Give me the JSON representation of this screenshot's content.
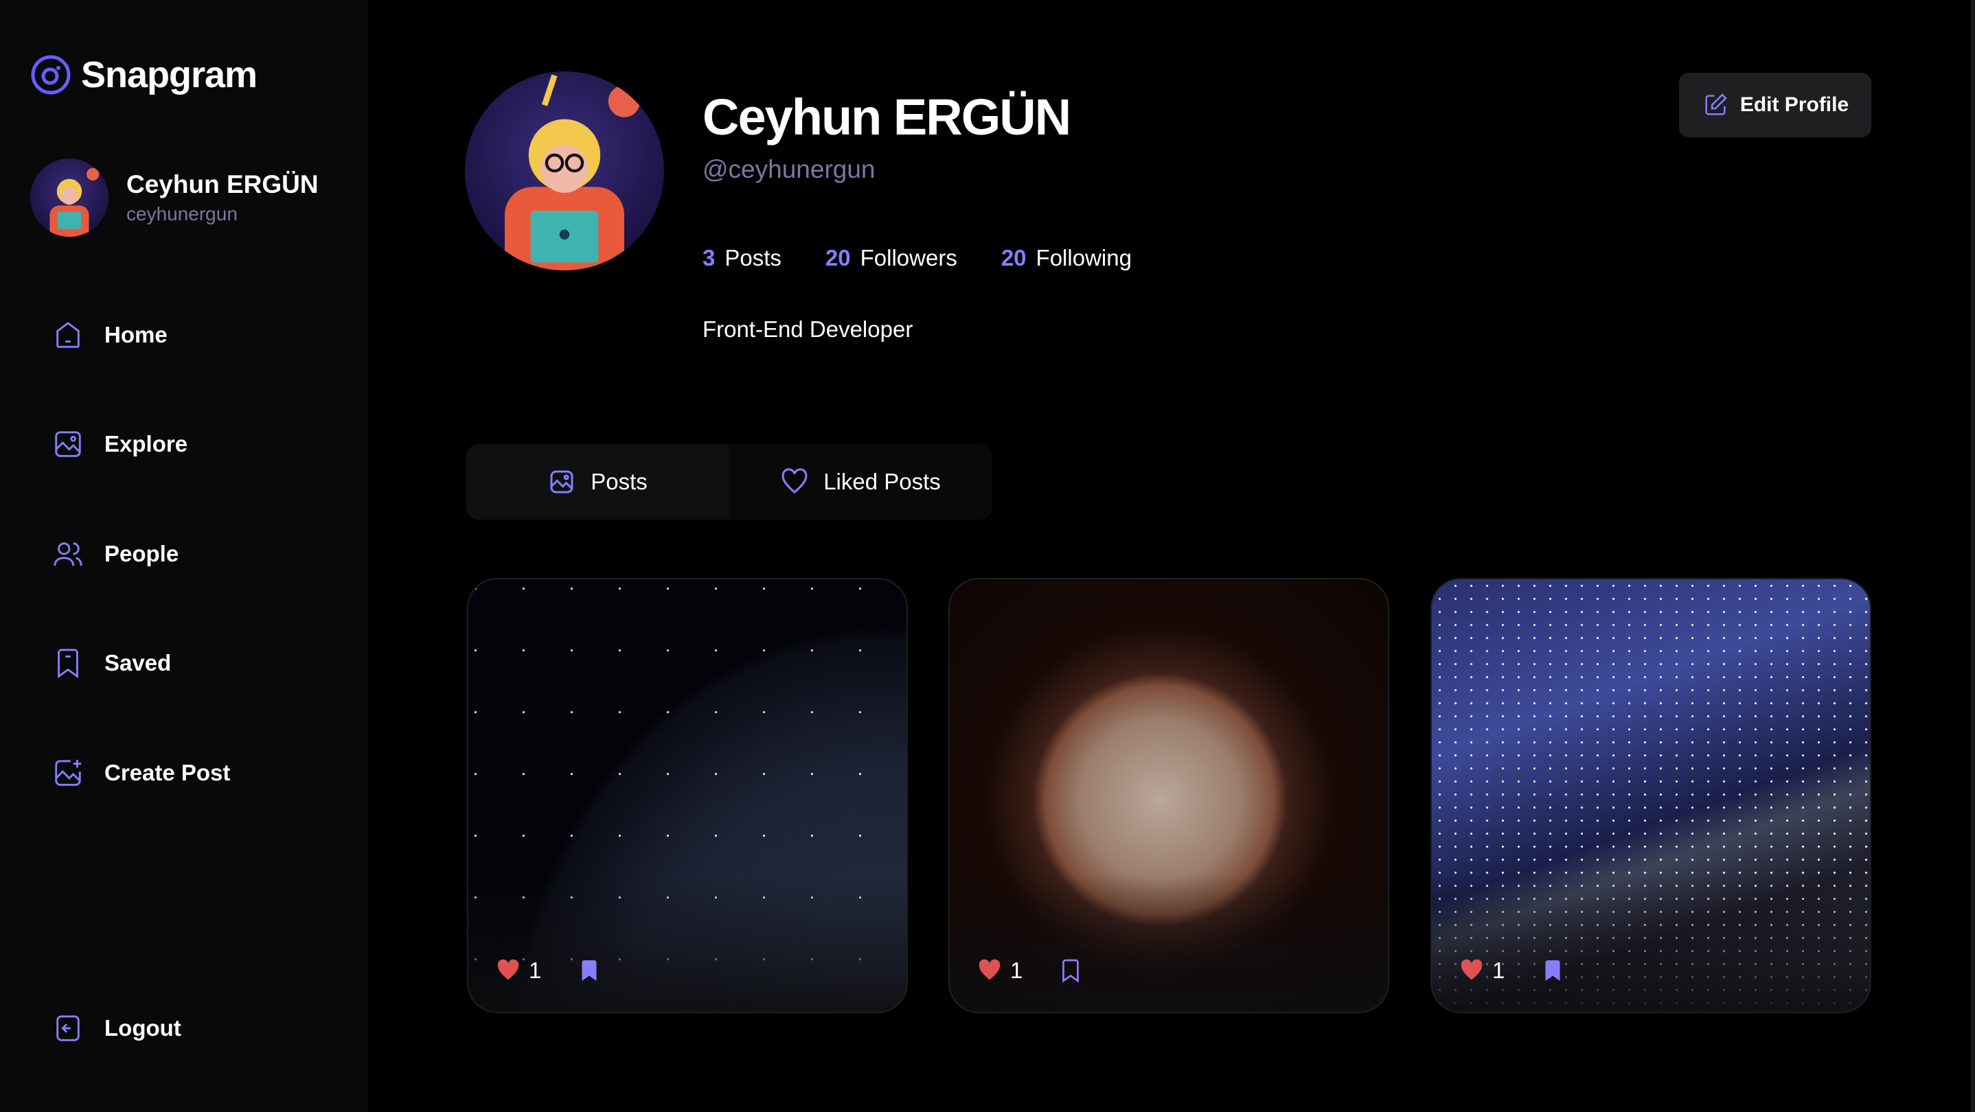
{
  "app": {
    "name": "Snapgram"
  },
  "sidebar": {
    "user": {
      "name": "Ceyhun ERGÜN",
      "handle": "ceyhunergun"
    },
    "items": [
      {
        "label": "Home"
      },
      {
        "label": "Explore"
      },
      {
        "label": "People"
      },
      {
        "label": "Saved"
      },
      {
        "label": "Create Post"
      }
    ],
    "logout": "Logout"
  },
  "profile": {
    "name": "Ceyhun ERGÜN",
    "handle": "@ceyhunergun",
    "bio": "Front-End Developer",
    "stats": [
      {
        "value": "3",
        "label": "Posts"
      },
      {
        "value": "20",
        "label": "Followers"
      },
      {
        "value": "20",
        "label": "Following"
      }
    ],
    "edit_label": "Edit Profile"
  },
  "tabs": [
    {
      "label": "Posts"
    },
    {
      "label": "Liked Posts"
    }
  ],
  "posts": [
    {
      "likes": "1",
      "saved": true
    },
    {
      "likes": "1",
      "saved": false
    },
    {
      "likes": "1",
      "saved": true
    }
  ],
  "colors": {
    "accent": "#877eff",
    "like": "#e05252",
    "muted": "#7878a3"
  }
}
